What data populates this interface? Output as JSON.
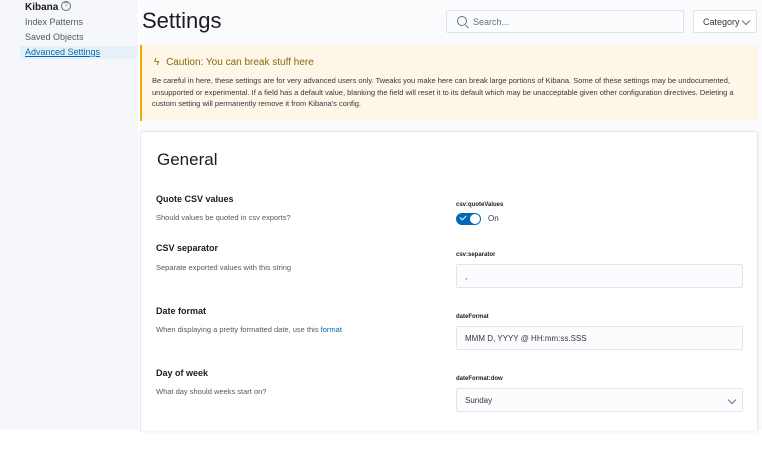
{
  "sidebar": {
    "title": "Kibana",
    "help_icon": "help-circle-icon",
    "items": [
      {
        "label": "Index Patterns",
        "active": false
      },
      {
        "label": "Saved Objects",
        "active": false
      },
      {
        "label": "Advanced Settings",
        "active": true
      }
    ]
  },
  "header": {
    "title": "Settings",
    "search_placeholder": "Search...",
    "category_label": "Category"
  },
  "callout": {
    "icon": "bolt-icon",
    "title": "Caution: You can break stuff here",
    "text": "Be careful in here, these settings are for very advanced users only. Tweaks you make here can break large portions of Kibana. Some of these settings may be undocumented, unsupported or experimental. If a field has a default value, blanking the field will reset it to its default which may be unacceptable given other configuration directives. Deleting a custom setting will permanently remove it from Kibana's config."
  },
  "general": {
    "title": "General",
    "settings": [
      {
        "title": "Quote CSV values",
        "description": "Should values be quoted in csv exports?",
        "key": "csv:quoteValues",
        "value": "On",
        "enabled": true
      },
      {
        "title": "CSV separator",
        "description": "Separate exported values with this string",
        "key": "csv:separator",
        "value": ","
      },
      {
        "title": "Date format",
        "description_prefix": "When displaying a pretty formatted date, use this ",
        "description_link": "format",
        "key": "dateFormat",
        "value": "MMM D, YYYY @ HH:mm:ss.SSS"
      },
      {
        "title": "Day of week",
        "description": "What day should weeks start on?",
        "key": "dateFormat:dow",
        "value": "Sunday"
      }
    ]
  },
  "colors": {
    "accent": "#006bb4",
    "warning_bg": "#fef6e6",
    "warning_border": "#f5a700"
  }
}
